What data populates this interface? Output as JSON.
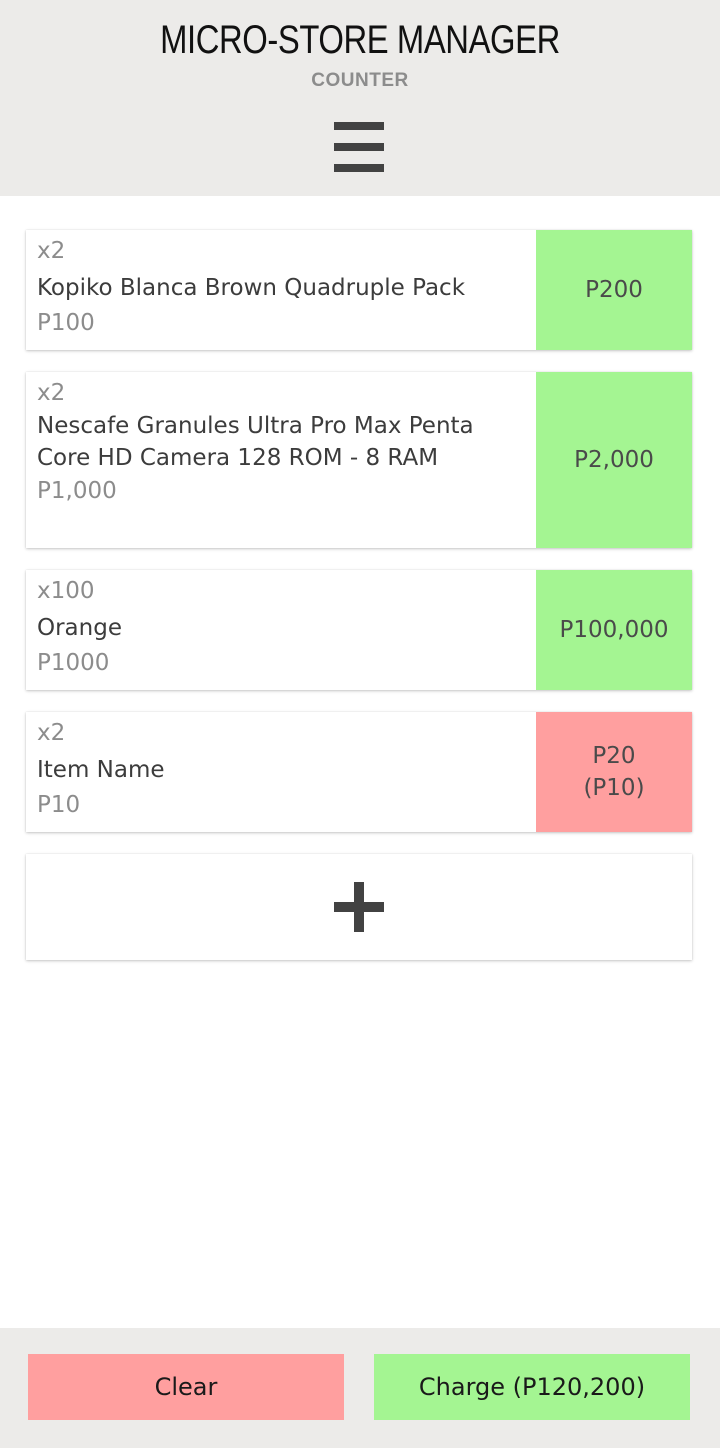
{
  "header": {
    "title": "MICRO-STORE MANAGER",
    "subtitle": "COUNTER",
    "menu_icon": "hamburger-menu-icon"
  },
  "items": [
    {
      "qty": "x2",
      "name": "Kopiko Blanca Brown Quadruple Pack",
      "unit_price": "P100",
      "total": "P200",
      "status": "positive"
    },
    {
      "qty": "x2",
      "name": "Nescafe Granules Ultra Pro Max Penta Core HD Camera 128 ROM - 8 RAM",
      "unit_price": "P1,000",
      "total": "P2,000",
      "status": "positive"
    },
    {
      "qty": "x100",
      "name": "Orange",
      "unit_price": "P1000",
      "total": "P100,000",
      "status": "positive"
    },
    {
      "qty": "x2",
      "name": "Item Name",
      "unit_price": "P10",
      "total": "P20\n(P10)",
      "status": "negative"
    }
  ],
  "add_item": {
    "icon": "plus-icon"
  },
  "footer": {
    "clear_label": "Clear",
    "charge_label": "Charge (P120,200)"
  },
  "colors": {
    "header_bg": "#ecebe9",
    "positive": "#a4f592",
    "negative": "#ff9f9f",
    "icon": "#424242"
  }
}
